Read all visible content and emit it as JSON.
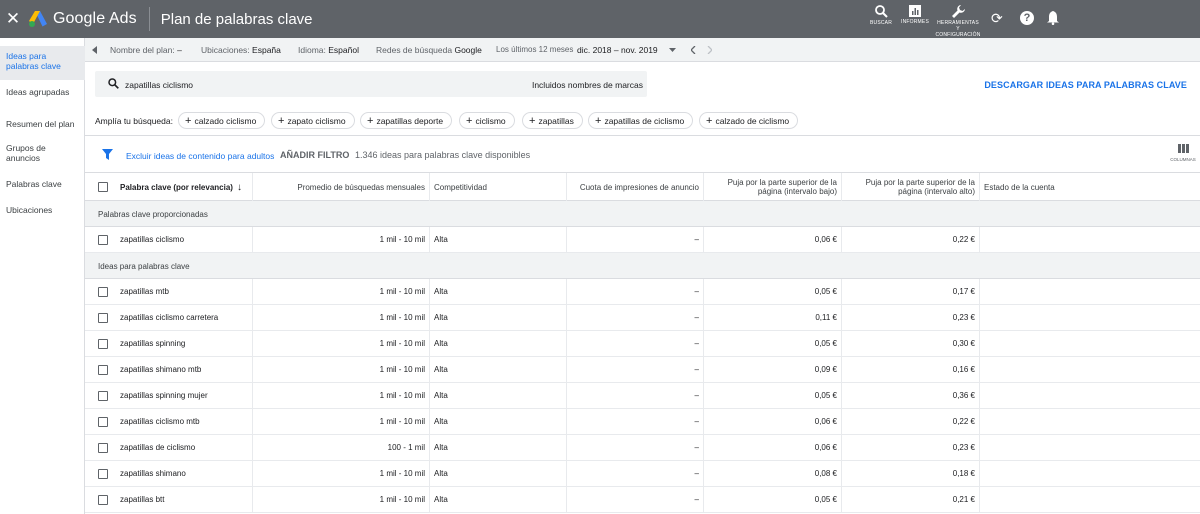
{
  "topbar": {
    "close": "✕",
    "brand": "Google Ads",
    "title": "Plan de palabras clave",
    "actions": {
      "search": "BUSCAR",
      "reports": "INFORMES",
      "tools": "HERRAMIENTAS Y CONFIGURACIÓN"
    }
  },
  "leftnav": {
    "items": [
      {
        "label": "Ideas para palabras clave",
        "active": true
      },
      {
        "label": "Ideas agrupadas"
      },
      {
        "label": "Resumen del plan"
      },
      {
        "label": "Grupos de anuncios"
      },
      {
        "label": "Palabras clave"
      },
      {
        "label": "Ubicaciones"
      }
    ]
  },
  "planbar": {
    "plan_name_label": "Nombre del plan:",
    "plan_name_value": "–",
    "locations_label": "Ubicaciones:",
    "locations_value": "España",
    "language_label": "Idioma:",
    "language_value": "Español",
    "networks_label": "Redes de búsqueda",
    "networks_value": "Google",
    "period_label": "Los últimos 12 meses",
    "period_value": "dic. 2018 – nov. 2019"
  },
  "search": {
    "query": "zapatillas ciclismo",
    "brand_names": "Incluidos nombres de marcas",
    "download": "DESCARGAR IDEAS PARA PALABRAS CLAVE"
  },
  "broaden": {
    "label": "Amplía tu búsqueda:",
    "chips": [
      "calzado ciclismo",
      "zapato ciclismo",
      "zapatillas deporte",
      "ciclismo",
      "zapatillas",
      "zapatillas de ciclismo",
      "calzado de ciclismo"
    ]
  },
  "filter": {
    "exclude_adult": "Excluir ideas de contenido para adultos",
    "add_filter": "AÑADIR FILTRO",
    "count": "1.346 ideas para palabras clave disponibles",
    "columns": "COLUMNAS"
  },
  "table": {
    "headers": {
      "keyword": "Palabra clave (por relevancia)",
      "avg": "Promedio de búsquedas mensuales",
      "competition": "Competitividad",
      "impression_share": "Cuota de impresiones de anuncio",
      "bid_low": "Puja por la parte superior de la página (intervalo bajo)",
      "bid_high": "Puja por la parte superior de la página (intervalo alto)",
      "account_status": "Estado de la cuenta"
    },
    "section_provided": "Palabras clave proporcionadas",
    "section_ideas": "Ideas para palabras clave",
    "provided_rows": [
      {
        "kw": "zapatillas ciclismo",
        "avg": "1 mil - 10 mil",
        "comp": "Alta",
        "imp": "–",
        "low": "0,06 €",
        "high": "0,22 €"
      }
    ],
    "idea_rows": [
      {
        "kw": "zapatillas mtb",
        "avg": "1 mil - 10 mil",
        "comp": "Alta",
        "imp": "–",
        "low": "0,05 €",
        "high": "0,17 €"
      },
      {
        "kw": "zapatillas ciclismo carretera",
        "avg": "1 mil - 10 mil",
        "comp": "Alta",
        "imp": "–",
        "low": "0,11 €",
        "high": "0,23 €"
      },
      {
        "kw": "zapatillas spinning",
        "avg": "1 mil - 10 mil",
        "comp": "Alta",
        "imp": "–",
        "low": "0,05 €",
        "high": "0,30 €"
      },
      {
        "kw": "zapatillas shimano mtb",
        "avg": "1 mil - 10 mil",
        "comp": "Alta",
        "imp": "–",
        "low": "0,09 €",
        "high": "0,16 €"
      },
      {
        "kw": "zapatillas spinning mujer",
        "avg": "1 mil - 10 mil",
        "comp": "Alta",
        "imp": "–",
        "low": "0,05 €",
        "high": "0,36 €"
      },
      {
        "kw": "zapatillas ciclismo mtb",
        "avg": "1 mil - 10 mil",
        "comp": "Alta",
        "imp": "–",
        "low": "0,06 €",
        "high": "0,22 €"
      },
      {
        "kw": "zapatillas de ciclismo",
        "avg": "100 - 1 mil",
        "comp": "Alta",
        "imp": "–",
        "low": "0,06 €",
        "high": "0,23 €"
      },
      {
        "kw": "zapatillas shimano",
        "avg": "1 mil - 10 mil",
        "comp": "Alta",
        "imp": "–",
        "low": "0,08 €",
        "high": "0,18 €"
      },
      {
        "kw": "zapatillas btt",
        "avg": "1 mil - 10 mil",
        "comp": "Alta",
        "imp": "–",
        "low": "0,05 €",
        "high": "0,21 €"
      }
    ]
  },
  "colors": {
    "topbar": "#5f6368",
    "accent": "#1a73e8",
    "section_bg": "#f1f3f4"
  }
}
